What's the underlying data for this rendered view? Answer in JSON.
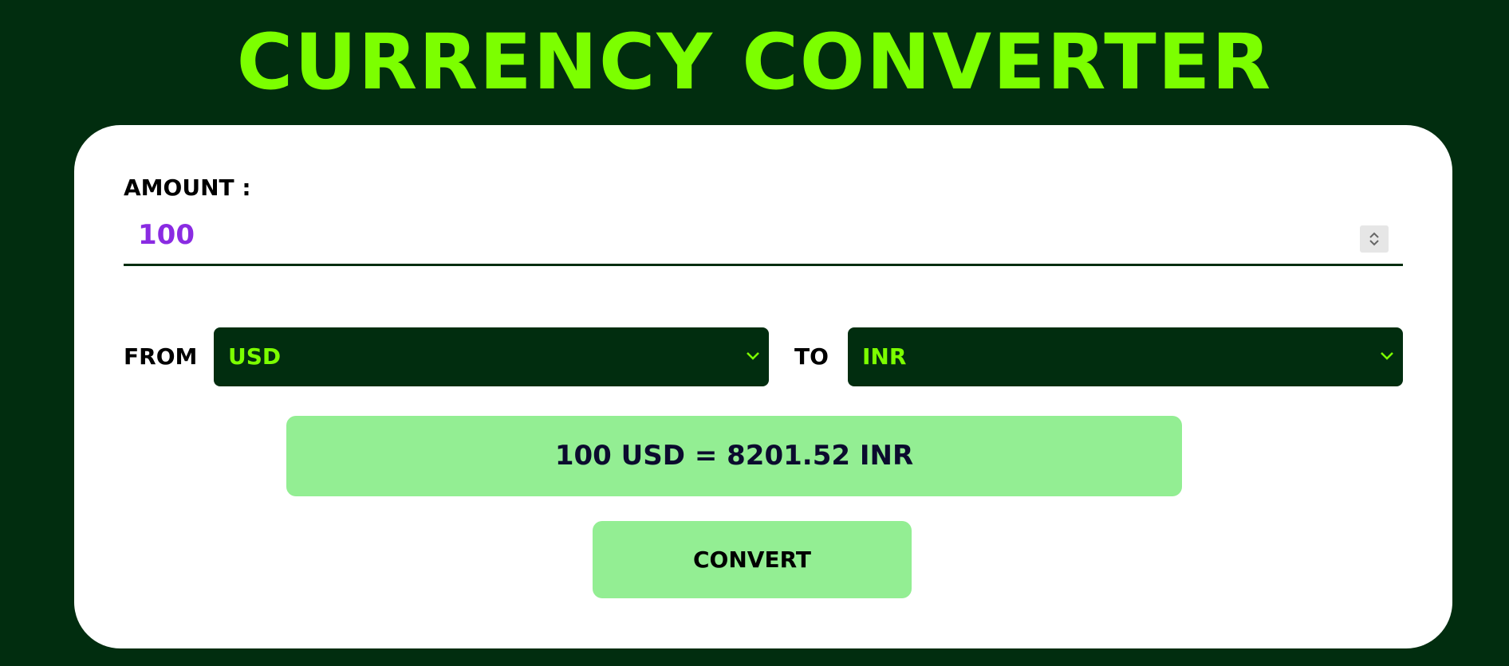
{
  "header": {
    "title": "CURRENCY CONVERTER"
  },
  "form": {
    "amount_label": "AMOUNT :",
    "amount_value": "100",
    "from_label": "FROM",
    "from_value": "USD",
    "to_label": "TO",
    "to_value": "INR",
    "result_text": "100 USD = 8201.52 INR",
    "convert_label": "CONVERT"
  },
  "colors": {
    "background": "#012d0f",
    "accent": "#7cff00",
    "card": "#ffffff",
    "button": "#93ee93",
    "amount_text": "#8a2be2"
  },
  "icons": {
    "spinner": "number-spinner-icon",
    "dropdown": "chevron-down-icon"
  }
}
